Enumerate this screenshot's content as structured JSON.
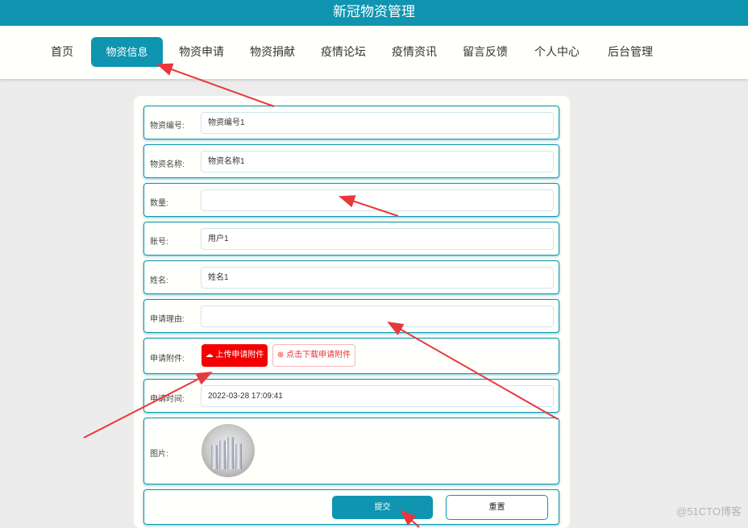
{
  "app": {
    "title": "新冠物资管理"
  },
  "nav": {
    "items": [
      {
        "label": "首页"
      },
      {
        "label": "物资信息"
      },
      {
        "label": "物资申请"
      },
      {
        "label": "物资捐献"
      },
      {
        "label": "疫情论坛"
      },
      {
        "label": "疫情资讯"
      },
      {
        "label": "留言反馈"
      },
      {
        "label": "个人中心"
      },
      {
        "label": "后台管理"
      }
    ],
    "active": "物资信息"
  },
  "form": {
    "item_no": {
      "label": "物资编号:",
      "value": "物资编号1"
    },
    "item_name": {
      "label": "物资名称:",
      "value": "物资名称1"
    },
    "quantity": {
      "label": "数量:",
      "value": ""
    },
    "account": {
      "label": "账号:",
      "value": "用户1"
    },
    "name": {
      "label": "姓名:",
      "value": "姓名1"
    },
    "reason": {
      "label": "申请理由:",
      "value": ""
    },
    "attachment": {
      "label": "申请附件:",
      "upload_label": "上传申请附件",
      "download_label": "点击下载申请附件"
    },
    "apply_time": {
      "label": "申请时间:",
      "value": "2022-03-28 17:09:41"
    },
    "image": {
      "label": "图片:"
    },
    "submit_label": "提交",
    "reset_label": "重置"
  },
  "watermark": "@51CTO博客",
  "colors": {
    "primary": "#0f95b0",
    "danger": "#f40000",
    "annotation": "#e8383d"
  }
}
